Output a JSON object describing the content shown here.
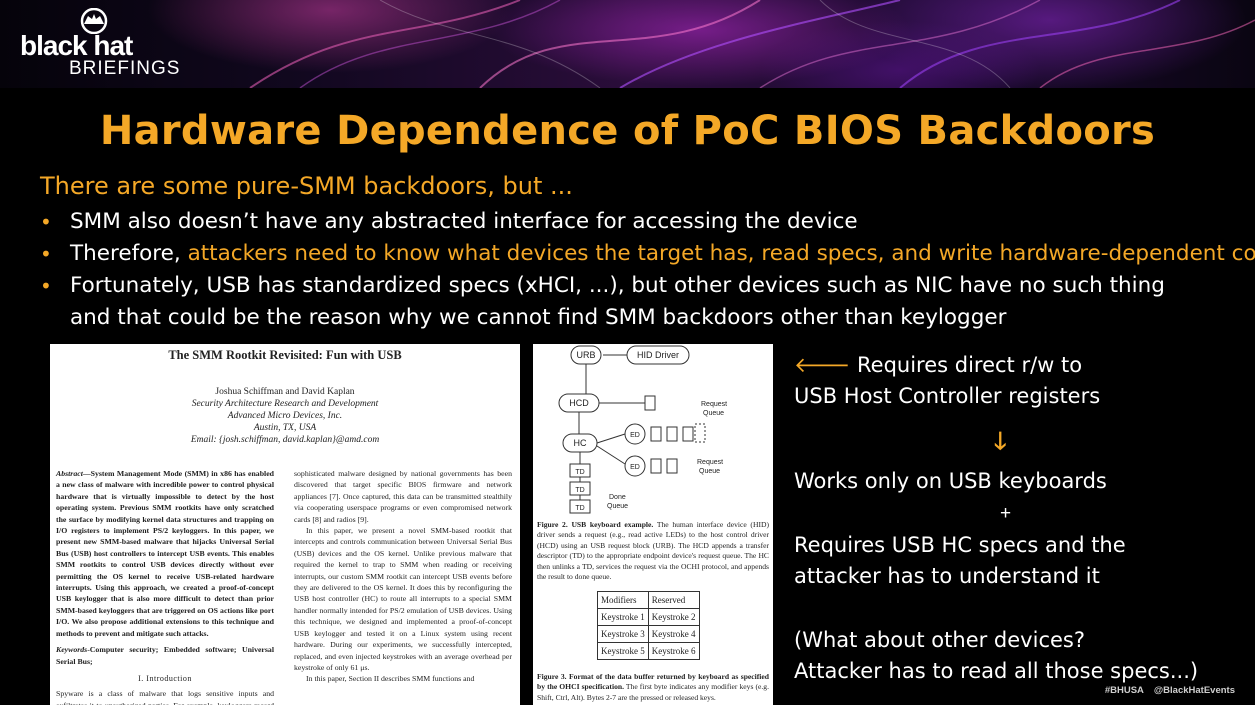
{
  "brand": {
    "logo_main": "black hat",
    "logo_sub": "BRIEFINGS"
  },
  "slide": {
    "title": "Hardware Dependence of PoC BIOS Backdoors",
    "subtitle": "There are some pure-SMM backdoors, but ...",
    "bullet1": "SMM also doesn’t have any abstracted interface for accessing the device",
    "bullet2_prefix": "Therefore, ",
    "bullet2_highlight": "attackers need to know what devices the target has, read specs, and write hardware-dependent code",
    "bullet3_line1": "Fortunately, USB has standardized specs (xHCI, ...), but other devices such as NIC have no such thing",
    "bullet3_line2": "and that could be the reason why we cannot find SMM backdoors other than keylogger"
  },
  "paper": {
    "title": "The SMM Rootkit Revisited: Fun with USB",
    "authors": "Joshua Schiffman and David Kaplan",
    "affil1": "Security Architecture Research and Development",
    "affil2": "Advanced Micro Devices, Inc.",
    "affil3": "Austin, TX, USA",
    "email": "Email: {josh.schiffman, david.kaplan}@amd.com",
    "abstract_label": "Abstract",
    "abstract_text": "—System Management Mode (SMM) in x86 has enabled a new class of malware with incredible power to control physical hardware that is virtually impossible to detect by the host operating system. Previous SMM rootkits have only scratched the surface by modifying kernel data structures and trapping on I/O registers to implement PS/2 keyloggers. In this paper, we present new SMM-based malware that hijacks Universal Serial Bus (USB) host controllers to intercept USB events. This enables SMM rootkits to control USB devices directly without ever permitting the OS kernel to receive USB-related hardware interrupts. Using this approach, we created a proof-of-concept USB keylogger that is also more difficult to detect than prior SMM-based keyloggers that are triggered on OS actions like port I/O. We also propose additional extensions to this technique and methods to prevent and mitigate such attacks.",
    "keywords_label": "Keywords",
    "keywords_text": "-Computer security; Embedded software; Universal Serial Bus;",
    "section": "I. Introduction",
    "intro": "Spyware is a class of malware that logs sensitive inputs and exfiltrates it to unauthorized parties. For example, keyloggers record user input without user awareness that",
    "right_col": "sophisticated malware designed by national governments has been discovered that target specific BIOS firmware and network appliances [7]. Once captured, this data can be transmitted stealthily via cooperating userspace programs or even compromised network cards [8] and radios [9].",
    "right_col2": "In this paper, we present a novel SMM-based rootkit that intercepts and controls communication between Universal Serial Bus (USB) devices and the OS kernel. Unlike previous malware that required the kernel to trap to SMM when reading or receiving interrupts, our custom SMM rootkit can intercept USB events before they are delivered to the OS kernel. It does this by reconfiguring the USB host controller (HC) to route all interrupts to a special SMM handler normally intended for PS/2 emulation of USB devices. Using this technique, we designed and implemented a proof-of-concept USB keylogger and tested it on a Linux system using recent hardware. During our experiments, we successfully intercepted, replaced, and even injected keystrokes with an average overhead per keystroke of only 61 μs.",
    "right_col3": "In this paper, Section II describes SMM functions and"
  },
  "figure": {
    "urb": "URB",
    "hid_driver": "HID Driver",
    "hcd": "HCD",
    "hc": "HC",
    "ed1": "ED",
    "ed2": "ED",
    "td1": "TD",
    "td2": "TD",
    "td3": "TD",
    "request_queue_1": "Request",
    "request_queue_1b": "Queue",
    "request_queue_2": "Request",
    "request_queue_2b": "Queue",
    "done_queue": "Done",
    "done_queue_b": "Queue",
    "fig2_label": "Figure 2.",
    "fig2_title": "USB keyboard example.",
    "fig2_text": " The human interface device (HID) driver sends a request (e.g., read active LEDs) to the host control driver (HCD) using an USB request block (URB). The HCD appends a transfer descriptor (TD) to the appropriate endpoint device's request queue. The HC then unlinks a TD, services the request via the OCHI protocol, and appends the result to done queue.",
    "table": [
      [
        "Modifiers",
        "Reserved"
      ],
      [
        "Keystroke 1",
        "Keystroke 2"
      ],
      [
        "Keystroke 3",
        "Keystroke 4"
      ],
      [
        "Keystroke 5",
        "Keystroke 6"
      ]
    ],
    "fig3_label": "Figure 3.",
    "fig3_title": "Format of the data buffer returned by keyboard as specified by the OHCI specification.",
    "fig3_text": " The first byte indicates any modifier keys (e.g. Shift, Ctrl, Alt). Bytes 2-7 are the pressed or released keys."
  },
  "side": {
    "arrow": "🡐",
    "line1": " Requires direct r/w to",
    "line2": "USB Host Controller registers",
    "down": "🡓",
    "line3": "Works only on USB keyboards",
    "plus": "+",
    "line4": "Requires USB HC specs and the",
    "line5": "attacker has to understand it",
    "line6": "(What about other devices?",
    "line7": "Attacker has to read all those specs...)"
  },
  "footer": {
    "tag1": "#BHUSA",
    "tag2": "@BlackHatEvents"
  },
  "colors": {
    "accent": "#f4a827",
    "background": "#000000"
  }
}
